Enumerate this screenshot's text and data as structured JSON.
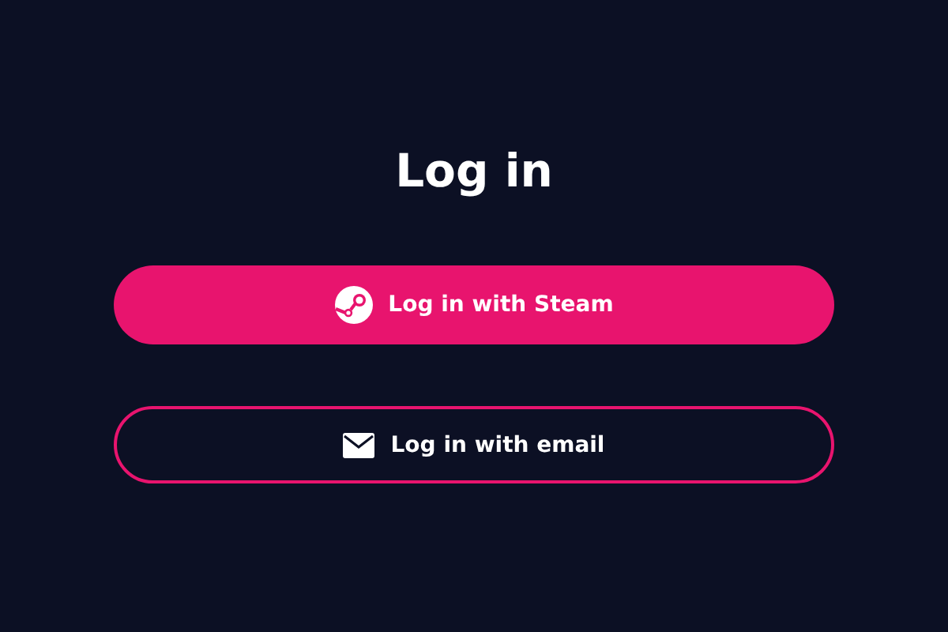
{
  "title": "Log in",
  "buttons": [
    {
      "label": "Log in with Steam",
      "kind": "filled"
    },
    {
      "label": "Log in with email",
      "kind": "outline"
    }
  ]
}
